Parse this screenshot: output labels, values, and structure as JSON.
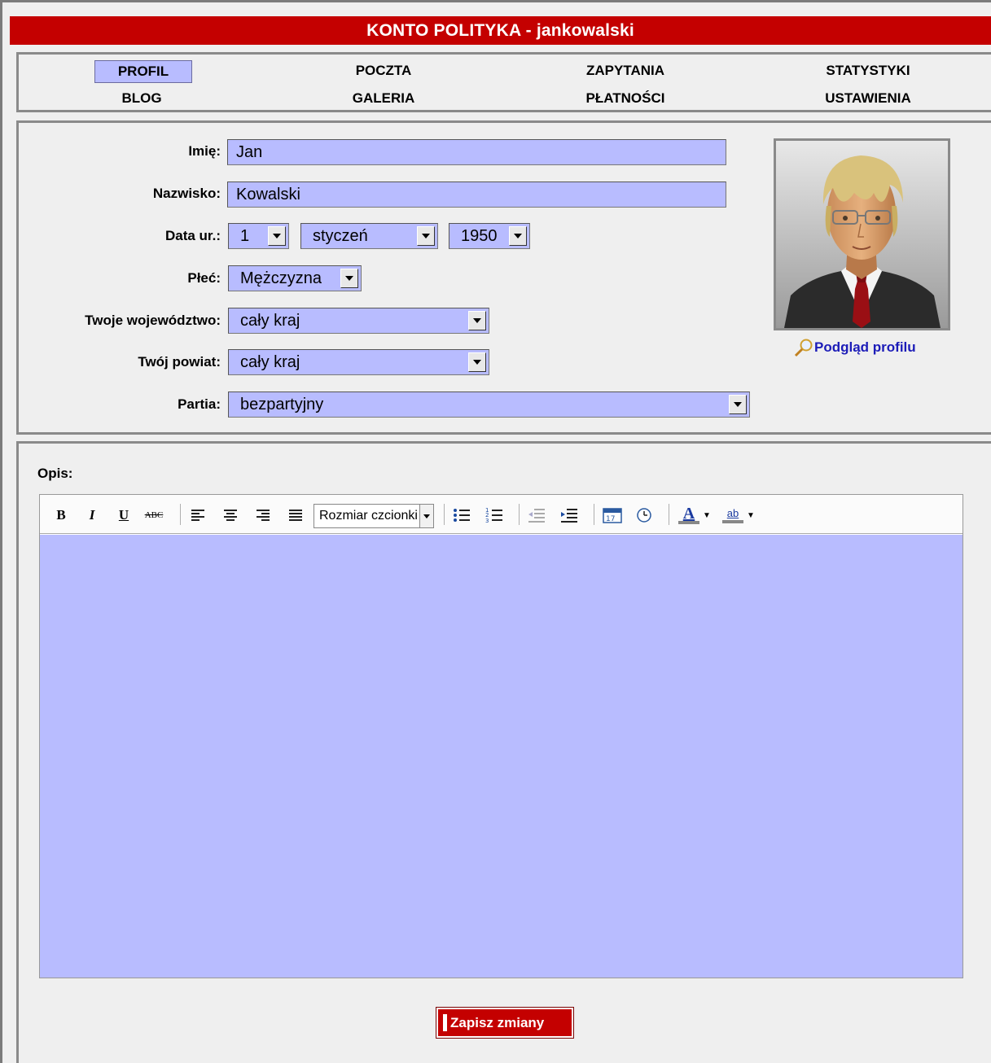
{
  "title": "KONTO POLITYKA - jankowalski",
  "nav": {
    "items": [
      {
        "label": "PROFIL",
        "active": true
      },
      {
        "label": "POCZTA"
      },
      {
        "label": "ZAPYTANIA"
      },
      {
        "label": "STATYSTYKI"
      },
      {
        "label": "BLOG"
      },
      {
        "label": "GALERIA"
      },
      {
        "label": "PŁATNOŚCI"
      },
      {
        "label": "USTAWIENIA"
      }
    ]
  },
  "form": {
    "first_name": {
      "label": "Imię:",
      "value": "Jan"
    },
    "last_name": {
      "label": "Nazwisko:",
      "value": "Kowalski"
    },
    "birth_date": {
      "label": "Data ur.:",
      "day": "1",
      "month": "styczeń",
      "year": "1950"
    },
    "gender": {
      "label": "Płeć:",
      "value": "Mężczyzna"
    },
    "voivodeship": {
      "label": "Twoje województwo:",
      "value": "cały kraj"
    },
    "county": {
      "label": "Twój powiat:",
      "value": "cały kraj"
    },
    "party": {
      "label": "Partia:",
      "value": "bezpartyjny"
    }
  },
  "profile": {
    "preview_label": "Podgląd profilu"
  },
  "description": {
    "label": "Opis:",
    "font_size_placeholder": "Rozmiar czcionki",
    "toolbar": {
      "bold": "B",
      "italic": "I",
      "underline": "U",
      "strikethrough": "ABC",
      "text_color": "A",
      "highlight": "ab"
    }
  },
  "save_label": "Zapisz zmiany",
  "colors": {
    "accent": "#c40000",
    "field_bg": "#b8bcff",
    "link": "#1c1cb8"
  }
}
